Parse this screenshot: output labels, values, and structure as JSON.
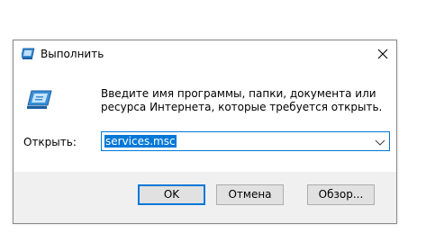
{
  "window": {
    "title": "Выполнить",
    "close_symbol": "✕"
  },
  "icons": {
    "title": "run-icon",
    "large": "run-icon",
    "close": "close-icon",
    "dropdown": "chevron-down-icon"
  },
  "description": "Введите имя программы, папки, документа или ресурса Интернета, которые требуется открыть.",
  "open_field": {
    "label": "Открыть:",
    "value": "services.msc"
  },
  "buttons": {
    "ok": "OK",
    "cancel": "Отмена",
    "browse": "Обзор..."
  },
  "colors": {
    "accent": "#0078d7",
    "dialog_bg": "#f0f0f0",
    "button_bg": "#e1e1e1"
  }
}
